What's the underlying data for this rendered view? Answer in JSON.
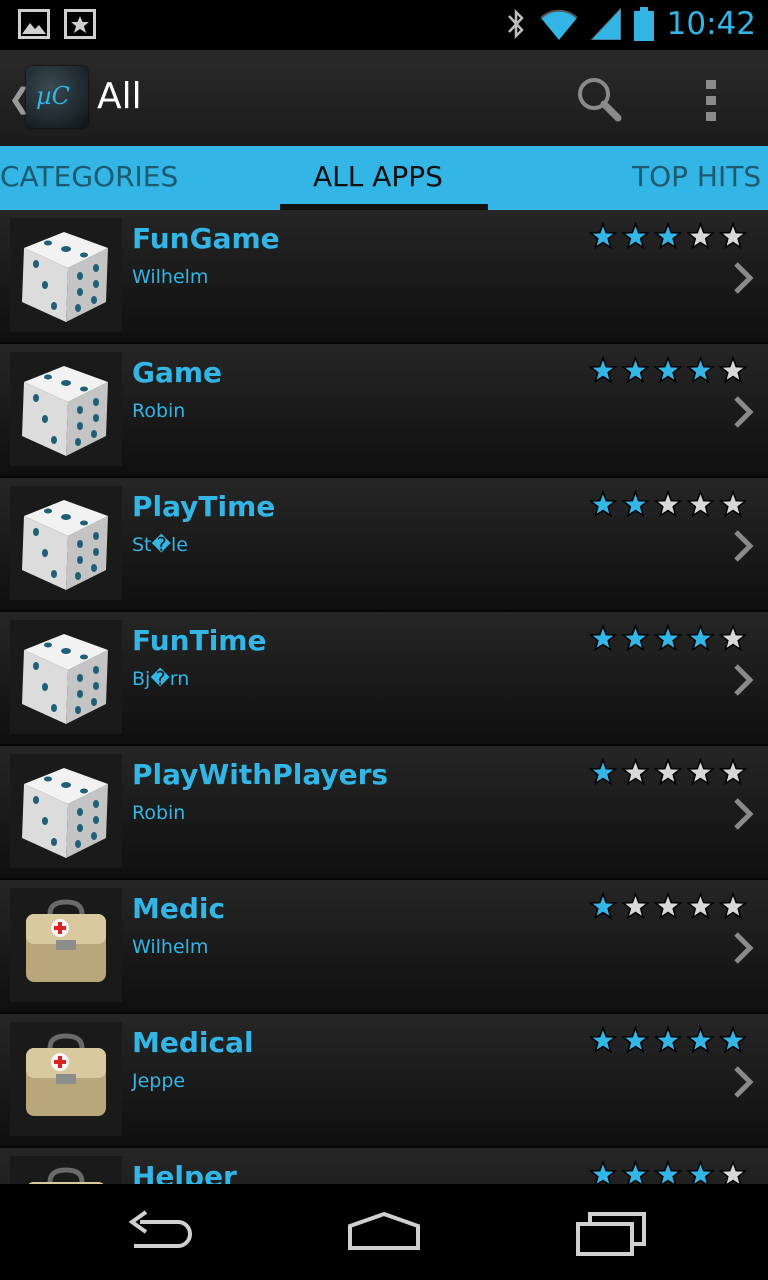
{
  "status_bar": {
    "time": "10:42",
    "left_icons": [
      "gallery-icon",
      "screenshot-icon"
    ],
    "right_icons": [
      "bluetooth-icon",
      "wifi-icon",
      "signal-icon",
      "battery-icon"
    ]
  },
  "action_bar": {
    "title": "All",
    "logo_text": "µC"
  },
  "tabs": [
    {
      "label": "CATEGORIES",
      "active": false
    },
    {
      "label": "ALL APPS",
      "active": true
    },
    {
      "label": "TOP HITS",
      "active": false
    }
  ],
  "apps": [
    {
      "name": "FunGame",
      "author": "Wilhelm",
      "rating": 3,
      "icon": "dice-icon"
    },
    {
      "name": "Game",
      "author": "Robin",
      "rating": 4,
      "icon": "dice-icon"
    },
    {
      "name": "PlayTime",
      "author": "St�le",
      "rating": 2,
      "icon": "dice-icon"
    },
    {
      "name": "FunTime",
      "author": "Bj�rn",
      "rating": 4,
      "icon": "dice-icon"
    },
    {
      "name": "PlayWithPlayers",
      "author": "Robin",
      "rating": 1,
      "icon": "dice-icon"
    },
    {
      "name": "Medic",
      "author": "Wilhelm",
      "rating": 1,
      "icon": "medical-bag-icon"
    },
    {
      "name": "Medical",
      "author": "Jeppe",
      "rating": 5,
      "icon": "medical-bag-icon"
    },
    {
      "name": "Helper",
      "author": "",
      "rating": 4,
      "icon": "medical-bag-icon"
    }
  ],
  "colors": {
    "accent": "#33b5e5",
    "star_filled": "#33b5e5",
    "star_empty": "#d8d8d8"
  }
}
